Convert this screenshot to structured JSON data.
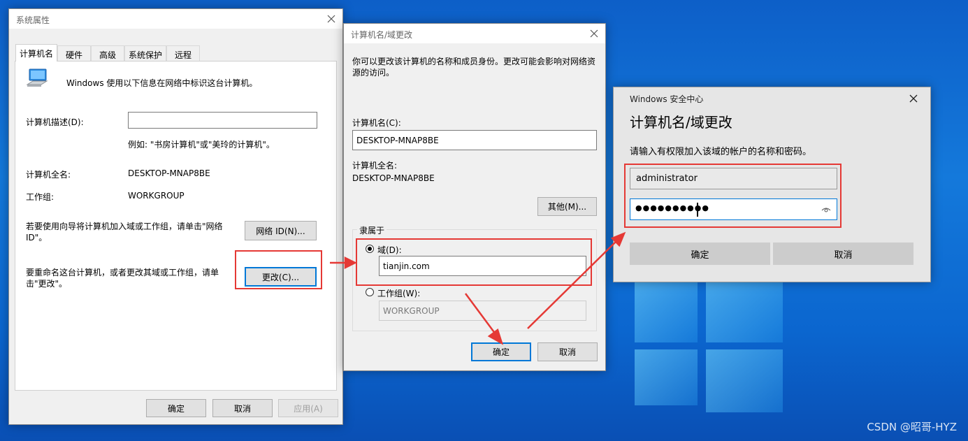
{
  "system_properties": {
    "title": "系统属性",
    "tabs": [
      "计算机名",
      "硬件",
      "高级",
      "系统保护",
      "远程"
    ],
    "intro": "Windows 使用以下信息在网络中标识这台计算机。",
    "desc_label": "计算机描述(D):",
    "desc_value": "",
    "example": "例如: \"书房计算机\"或\"美玲的计算机\"。",
    "fullname_label": "计算机全名:",
    "fullname_value": "DESKTOP-MNAP8BE",
    "workgroup_label": "工作组:",
    "workgroup_value": "WORKGROUP",
    "network_text": "若要使用向导将计算机加入域或工作组，请单击\"网络 ID\"。",
    "network_button": "网络 ID(N)...",
    "rename_text": "要重命名这台计算机，或者更改其域或工作组，请单击\"更改\"。",
    "change_button": "更改(C)...",
    "ok": "确定",
    "cancel": "取消",
    "apply": "应用(A)"
  },
  "domain_change": {
    "title": "计算机名/域更改",
    "description": "你可以更改该计算机的名称和成员身份。更改可能会影响对网络资源的访问。",
    "name_label": "计算机名(C):",
    "name_value": "DESKTOP-MNAP8BE",
    "fullname_label": "计算机全名:",
    "fullname_value": "DESKTOP-MNAP8BE",
    "other_button": "其他(M)...",
    "member_of_label": "隶属于",
    "domain_label": "域(D):",
    "domain_value": "tianjin.com",
    "workgroup_label": "工作组(W):",
    "workgroup_value": "WORKGROUP",
    "ok": "确定",
    "cancel": "取消"
  },
  "security": {
    "app_title": "Windows 安全中心",
    "heading": "计算机名/域更改",
    "prompt": "请输入有权限加入该域的帐户的名称和密码。",
    "username": "administrator",
    "password_mask": "●●●●●●●●●●",
    "ok": "确定",
    "cancel": "取消"
  },
  "watermark": "CSDN @昭哥-HYZ",
  "colors": {
    "accent": "#0078d7",
    "annotation_red": "#e53935",
    "desktop_blue": "#1479db"
  },
  "icons": [
    "close-icon",
    "computer-icon",
    "reveal-password-icon"
  ]
}
